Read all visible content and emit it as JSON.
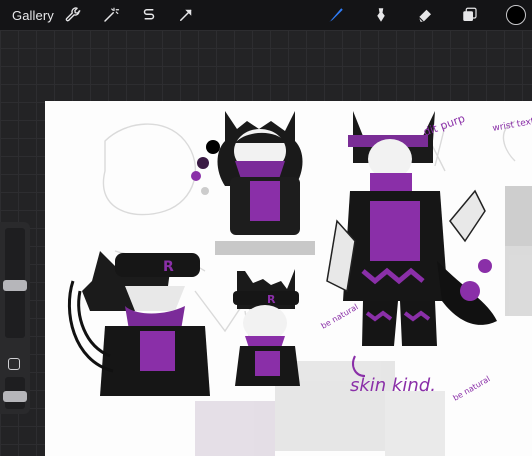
{
  "toolbar": {
    "gallery_label": "Gallery",
    "left_tools": [
      "wrench-icon",
      "magic-wand-icon",
      "selection-icon",
      "transform-arrow-icon"
    ],
    "right_tools": [
      "brush-icon",
      "smudge-icon",
      "eraser-icon",
      "layers-icon"
    ],
    "active_tool": "brush-icon",
    "active_color": "#000000",
    "accent_color": "#2f7cf6"
  },
  "sidebar": {
    "brush_size_level": 0.48,
    "opacity_level": 0.5
  },
  "canvas": {
    "handwritten_notes": [
      "skin kind.",
      "dit purp",
      "wrist text",
      "be natural",
      "be natural"
    ],
    "palette_colors": [
      "#000000",
      "#4a1f5c",
      "#8a2fa8",
      "#d9d9d9"
    ]
  }
}
